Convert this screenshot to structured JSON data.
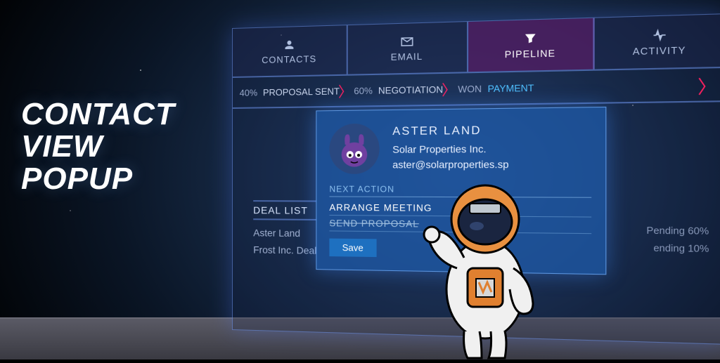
{
  "headline": {
    "l1": "CONTACT",
    "l2": "VIEW",
    "l3": "POPUP"
  },
  "tabs": [
    {
      "label": "CONTACTS"
    },
    {
      "label": "EMAIL"
    },
    {
      "label": "PIPELINE"
    },
    {
      "label": "ACTIVITY"
    }
  ],
  "stages": [
    {
      "pct": "40%",
      "label": "PROPOSAL SENT"
    },
    {
      "pct": "60%",
      "label": "NEGOTIATION"
    },
    {
      "pct": "WON",
      "label": "PAYMENT",
      "won": true
    }
  ],
  "dealList": {
    "title": "DEAL LIST",
    "items": [
      "Aster Land",
      "Frost Inc. Deal"
    ]
  },
  "sideItems": [
    "Pending 60%",
    "ending 10%"
  ],
  "popup": {
    "name": "ASTER LAND",
    "company": "Solar Properties Inc.",
    "email": "aster@solarproperties.sp",
    "nextLabel": "NEXT ACTION",
    "actions": [
      {
        "label": "ARRANGE MEETING",
        "done": false
      },
      {
        "label": "SEND PROPOSAL",
        "done": true
      }
    ],
    "saveLabel": "Save"
  }
}
